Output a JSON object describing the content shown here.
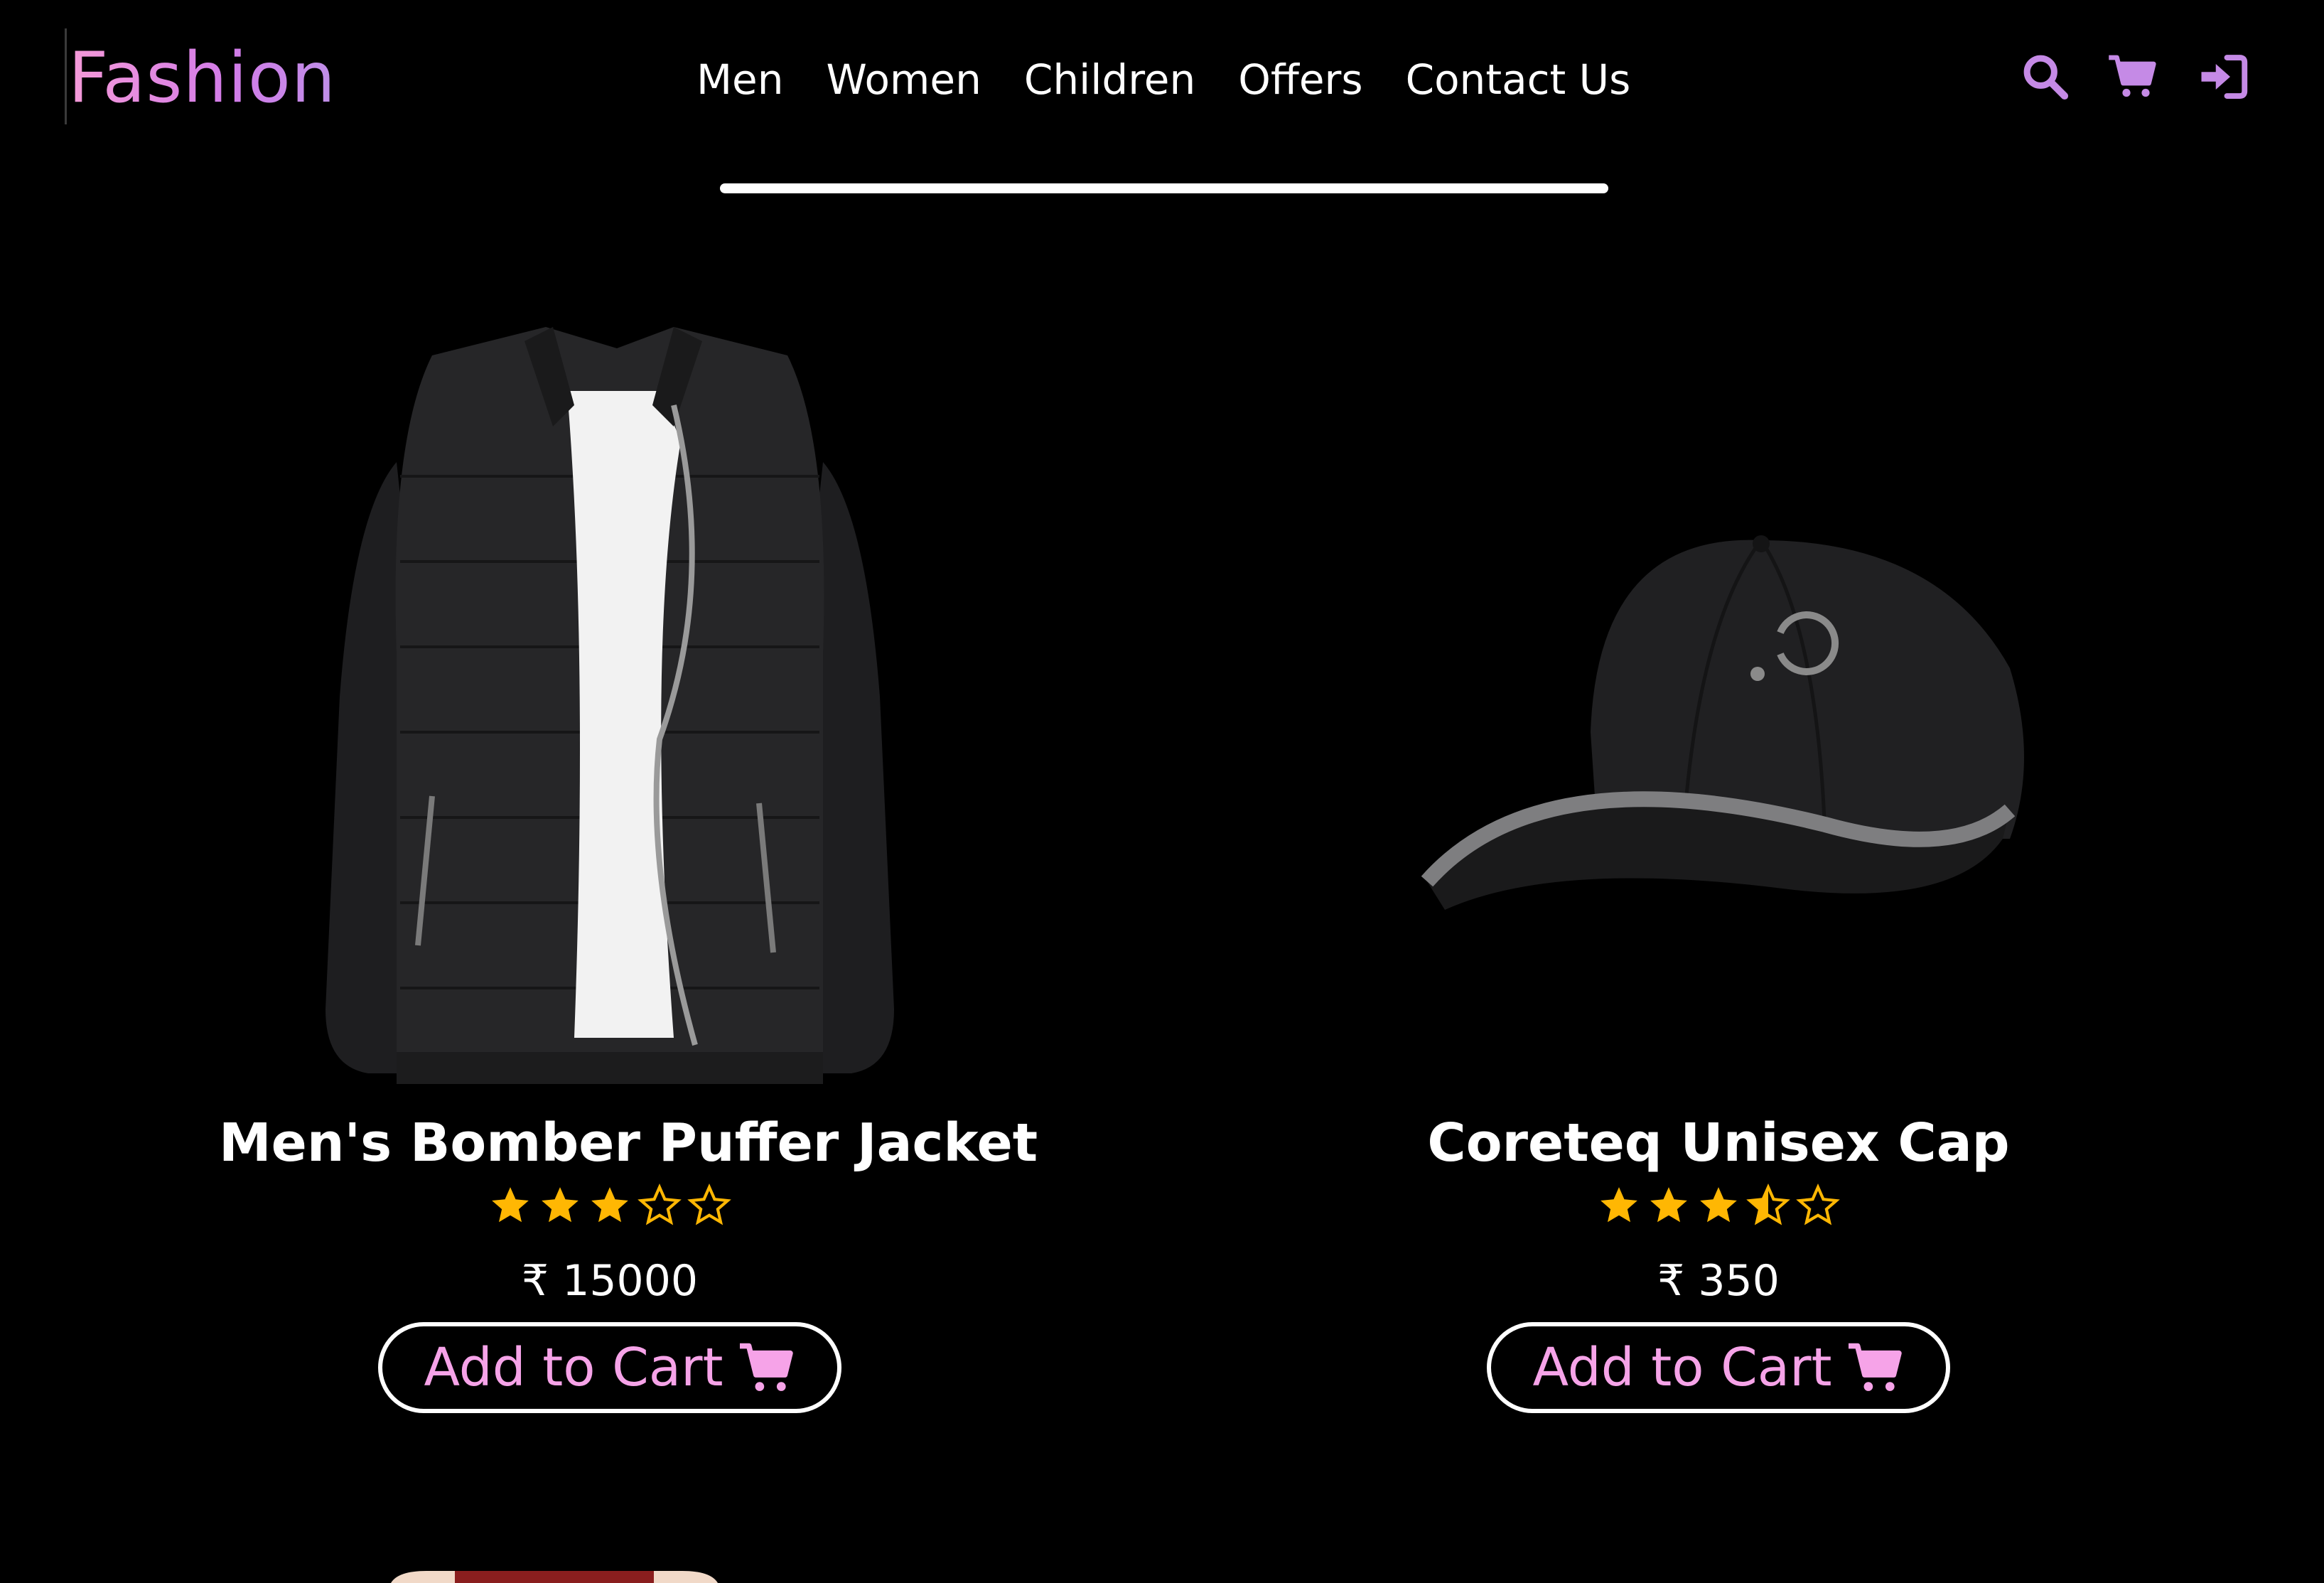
{
  "brand": {
    "name": "Fashion",
    "color": "#e98ae0"
  },
  "nav": {
    "items": [
      {
        "label": "Men"
      },
      {
        "label": "Women"
      },
      {
        "label": "Children"
      },
      {
        "label": "Offers"
      },
      {
        "label": "Contact Us"
      }
    ]
  },
  "header_icons": [
    "search-icon",
    "cart-icon",
    "sign-in-icon"
  ],
  "accent_color": "#c58ae6",
  "star_color": "#ffb703",
  "products": [
    {
      "name": "Men's Bomber Puffer Jacket",
      "rating": 3,
      "currency": "₹",
      "price": "15000",
      "button_label": "Add to Cart"
    },
    {
      "name": "Coreteq Unisex Cap",
      "rating": 3.5,
      "currency": "₹",
      "price": "350",
      "button_label": "Add to Cart"
    }
  ]
}
